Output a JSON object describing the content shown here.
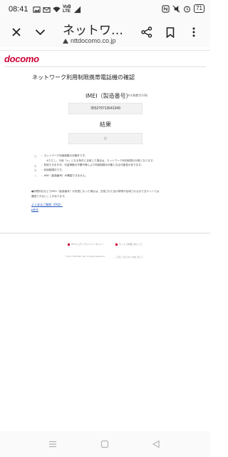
{
  "status_bar": {
    "time": "08:41",
    "volte_top": "VoB",
    "volte_bottom": "LTE",
    "battery": "71"
  },
  "toolbar": {
    "page_title": "ネットワ…",
    "url": "nttdocomo.co.jp",
    "icons": [
      "close-icon",
      "chevron-down-icon",
      "share-icon",
      "bookmark-icon",
      "more-icon"
    ]
  },
  "page": {
    "logo": "docomo",
    "heading": "ネットワーク利用制限携帯電話機の確認",
    "imei_label": "IMEI（製造番号）",
    "imei_note": "※半角数字14桁",
    "imei_value": "355279713641349",
    "result_label": "結果",
    "result_symbol": "○",
    "legend": [
      {
        "symbol": "○",
        "text": "：ネットワーク利用制限の対象外です。"
      },
      {
        "symbol": "△",
        "text": "：利用できますが、代金債務の不履行等により利用制限の対象となる可能性があります。"
      },
      {
        "symbol": "×",
        "text": "：利用制限中です。"
      },
      {
        "symbol": "－",
        "text": "：IMEI（製造番号）が確認できません。"
      }
    ],
    "legend_sub": "※ただし、今後「×」となる条件に合致した場合は、ネットワーク利用制限の対象となります。",
    "notes_line1": "●修理対応などでIMEI（製造番号）が変更になった場合は、交換された旧の携帯が反映されるまで当サイトでは",
    "notes_line2": "確認できないことがあります。",
    "faq_link": "よくあるご質問（FAQ）",
    "back_link": "▸戻る",
    "footer_links": [
      "NTTドコモ プライバシーポリシー",
      "サイトご利用にあたって"
    ],
    "footer_copy": [
      "©2017 DOCOMO, INC. All Rights Reserved.",
      "ご注意：表示された内容に関して…"
    ]
  }
}
